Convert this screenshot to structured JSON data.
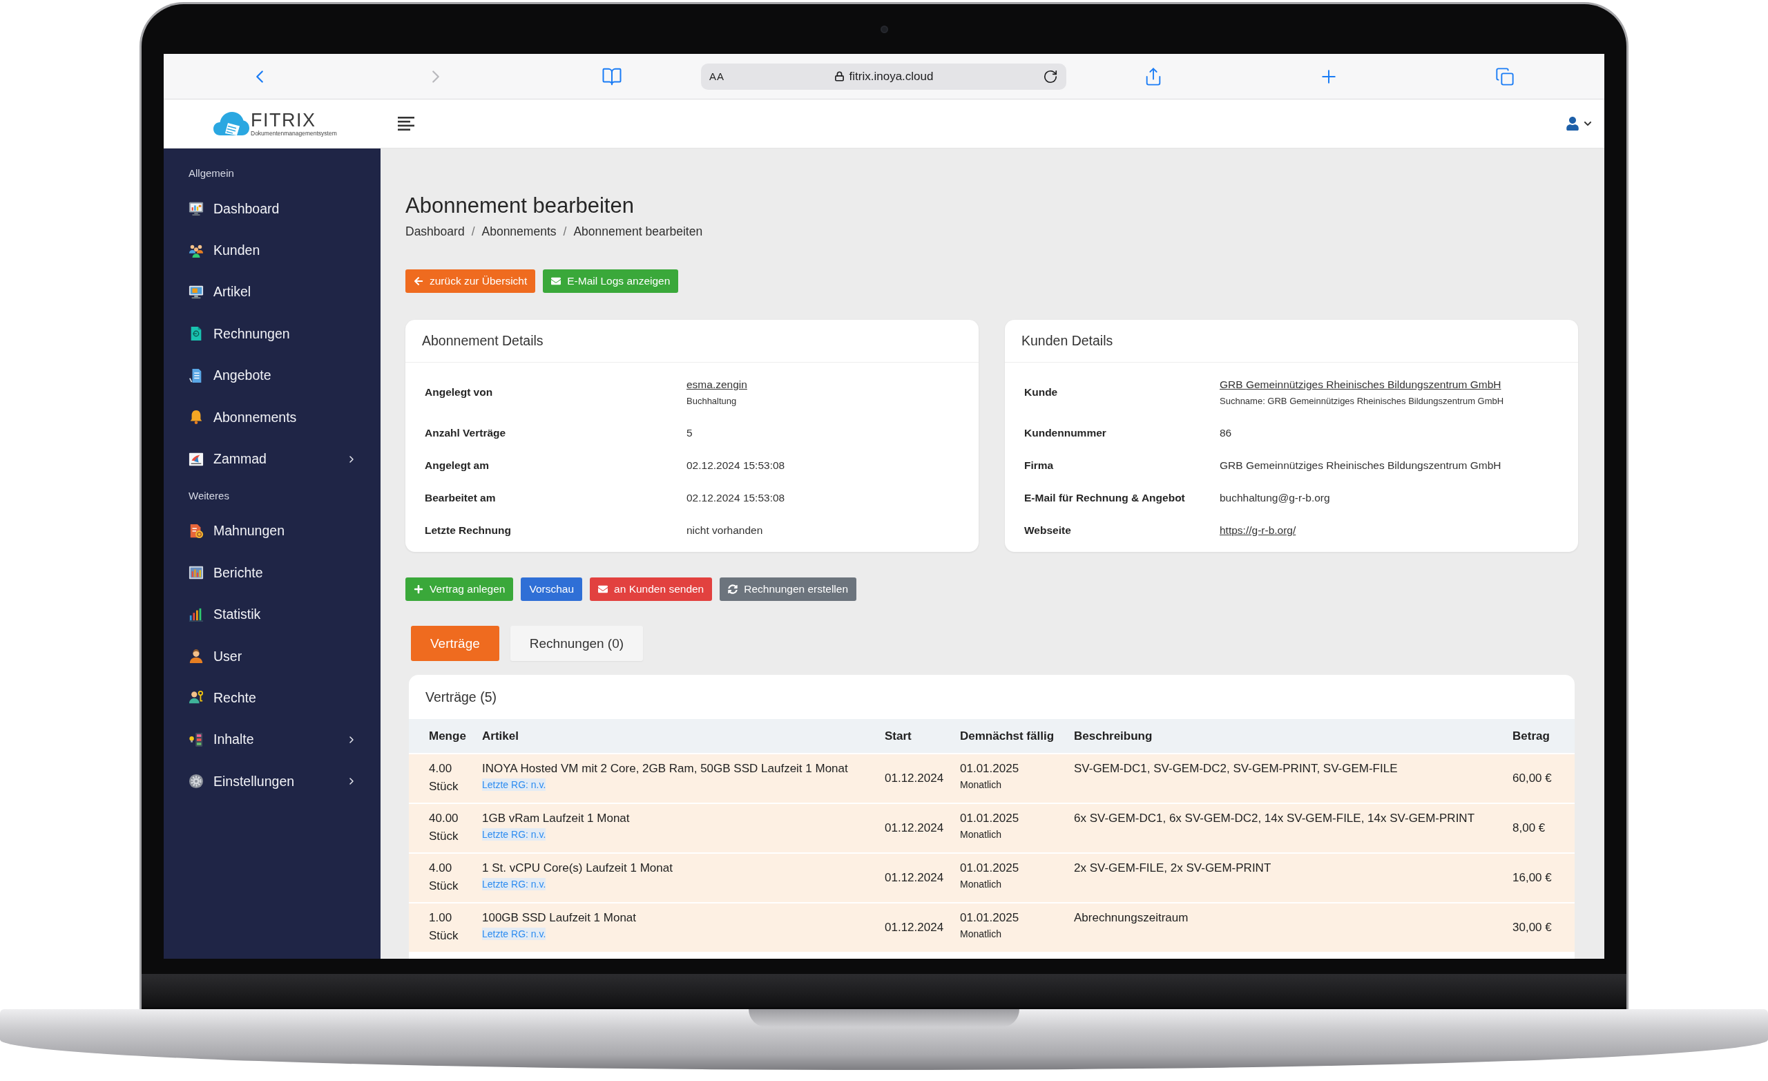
{
  "browser": {
    "text_size_label": "AA",
    "url": "fitrix.inoya.cloud"
  },
  "header": {
    "logo": {
      "name": "FITRIX",
      "tagline": "Dokumentenmanagementsystem"
    }
  },
  "sidebar": {
    "sections": [
      {
        "label": "Allgemein",
        "items": [
          {
            "label": "Dashboard",
            "has_submenu": false
          },
          {
            "label": "Kunden",
            "has_submenu": false
          },
          {
            "label": "Artikel",
            "has_submenu": false
          },
          {
            "label": "Rechnungen",
            "has_submenu": false
          },
          {
            "label": "Angebote",
            "has_submenu": false
          },
          {
            "label": "Abonnements",
            "has_submenu": false
          },
          {
            "label": "Zammad",
            "has_submenu": true
          }
        ]
      },
      {
        "label": "Weiteres",
        "items": [
          {
            "label": "Mahnungen",
            "has_submenu": false
          },
          {
            "label": "Berichte",
            "has_submenu": false
          },
          {
            "label": "Statistik",
            "has_submenu": false
          },
          {
            "label": "User",
            "has_submenu": false
          },
          {
            "label": "Rechte",
            "has_submenu": false
          },
          {
            "label": "Inhalte",
            "has_submenu": true
          },
          {
            "label": "Einstellungen",
            "has_submenu": true
          }
        ]
      }
    ]
  },
  "page": {
    "title": "Abonnement bearbeiten",
    "breadcrumb": {
      "separator": "/",
      "items": [
        "Dashboard",
        "Abonnements",
        "Abonnement bearbeiten"
      ]
    }
  },
  "actions": [
    {
      "label": "zurück zur Übersicht",
      "kind": "back",
      "color": "#ef6b1f"
    },
    {
      "label": "E-Mail Logs anzeigen",
      "kind": "email",
      "color": "#3aa83a"
    }
  ],
  "subscription_details": {
    "title": "Abonnement Details",
    "rows": [
      {
        "label": "Angelegt von",
        "value": "esma.zengin",
        "kind": "link",
        "note": "Buchhaltung"
      },
      {
        "label": "Anzahl Verträge",
        "value": "5",
        "kind": "text"
      },
      {
        "label": "Angelegt am",
        "value": "02.12.2024 15:53:08",
        "kind": "text"
      },
      {
        "label": "Bearbeitet am",
        "value": "02.12.2024 15:53:08",
        "kind": "text"
      },
      {
        "label": "Letzte Rechnung",
        "value": "nicht vorhanden",
        "kind": "text"
      }
    ]
  },
  "customer_details": {
    "title": "Kunden Details",
    "rows": [
      {
        "label": "Kunde",
        "value": "GRB Gemeinnütziges Rheinisches Bildungszentrum GmbH",
        "kind": "link",
        "note": "Suchname: GRB Gemeinnütziges Rheinisches Bildungszentrum GmbH"
      },
      {
        "label": "Kundennummer",
        "value": "86",
        "kind": "text"
      },
      {
        "label": "Firma",
        "value": "GRB Gemeinnütziges Rheinisches Bildungszentrum GmbH",
        "kind": "text"
      },
      {
        "label": "E-Mail für Rechnung & Angebot",
        "value": "buchhaltung@g-r-b.org",
        "kind": "text"
      },
      {
        "label": "Webseite",
        "value": "https://g-r-b.org/",
        "kind": "link"
      }
    ]
  },
  "contract_actions": [
    {
      "label": "Vertrag anlegen",
      "kind": "add",
      "color": "#3aa83a"
    },
    {
      "label": "Vorschau",
      "kind": "preview",
      "color": "#2f6fd6"
    },
    {
      "label": "an Kunden senden",
      "kind": "send",
      "color": "#e2413f"
    },
    {
      "label": "Rechnungen erstellen",
      "kind": "refresh",
      "color": "#6c747d"
    }
  ],
  "tabs": [
    {
      "label": "Verträge",
      "selected": true
    },
    {
      "label": "Rechnungen (0)",
      "selected": false
    }
  ],
  "contracts": {
    "title": "Verträge (5)",
    "columns": [
      "Menge",
      "Artikel",
      "Start",
      "Demnächst fällig",
      "Beschreibung",
      "Betrag"
    ],
    "rows": [
      {
        "quantity": "4.00",
        "unit": "Stück",
        "article": "INOYA Hosted VM mit 2 Core, 2GB Ram, 50GB SSD Laufzeit 1 Monat",
        "last_invoice": "Letzte RG: n.v.",
        "start": "01.12.2024",
        "due": "01.01.2025",
        "interval": "Monatlich",
        "description": "SV-GEM-DC1, SV-GEM-DC2, SV-GEM-PRINT, SV-GEM-FILE",
        "amount": "60,00 €"
      },
      {
        "quantity": "40.00",
        "unit": "Stück",
        "article": "1GB vRam Laufzeit 1 Monat",
        "last_invoice": "Letzte RG: n.v.",
        "start": "01.12.2024",
        "due": "01.01.2025",
        "interval": "Monatlich",
        "description": "6x SV-GEM-DC1, 6x SV-GEM-DC2, 14x SV-GEM-FILE, 14x SV-GEM-PRINT",
        "amount": "8,00 €"
      },
      {
        "quantity": "4.00",
        "unit": "Stück",
        "article": "1 St. vCPU Core(s) Laufzeit 1 Monat",
        "last_invoice": "Letzte RG: n.v.",
        "start": "01.12.2024",
        "due": "01.01.2025",
        "interval": "Monatlich",
        "description": "2x SV-GEM-FILE, 2x SV-GEM-PRINT",
        "amount": "16,00 €"
      },
      {
        "quantity": "1.00",
        "unit": "Stück",
        "article": "100GB SSD Laufzeit 1 Monat",
        "last_invoice": "Letzte RG: n.v.",
        "start": "01.12.2024",
        "due": "01.01.2025",
        "interval": "Monatlich",
        "description": "Abrechnungszeitraum",
        "amount": "30,00 €"
      }
    ]
  }
}
